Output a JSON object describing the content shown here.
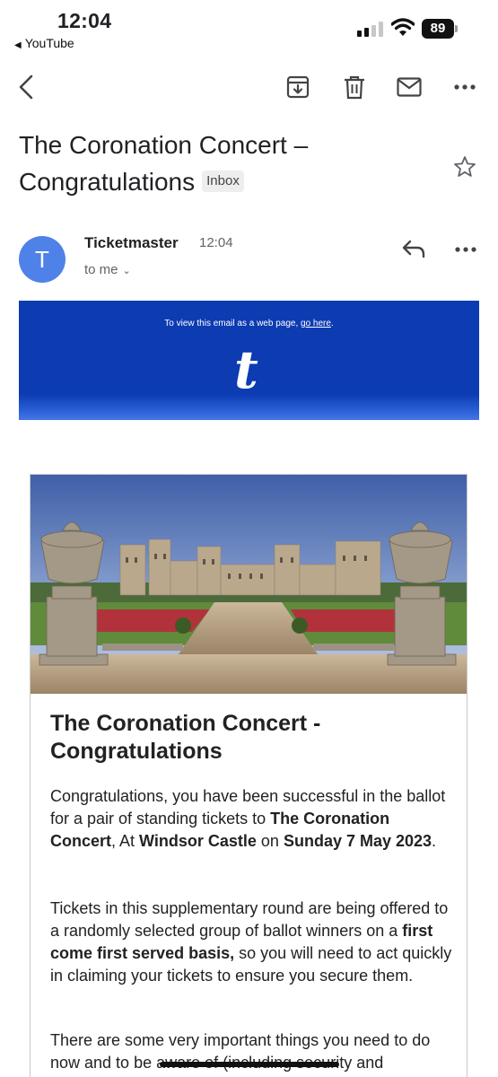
{
  "status_bar": {
    "time": "12:04",
    "back_app": "YouTube",
    "battery": "89"
  },
  "toolbar": {
    "back_icon": "chevron-left-icon",
    "archive_icon": "archive-icon",
    "delete_icon": "trash-icon",
    "mark_unread_icon": "mail-icon",
    "more_icon": "more-horizontal-icon"
  },
  "email": {
    "subject_line1": "The Coronation Concert –",
    "subject_line2": "Congratulations",
    "label": "Inbox",
    "star_icon": "star-outline-icon",
    "sender_initial": "T",
    "sender_name": "Ticketmaster",
    "time": "12:04",
    "recipient": "to me",
    "reply_icon": "reply-icon",
    "accent_color": "#4f82e8"
  },
  "banner": {
    "text_prefix": "To view this email as a web page, ",
    "link_text": "go here",
    "text_suffix": ".",
    "logo": "t",
    "color": "#0c3bb2"
  },
  "content": {
    "title_line1": "The Coronation Concert -",
    "title_line2": "Congratulations",
    "p1": {
      "a": "Congratulations, you have been successful in the ballot for a pair of standing tickets to ",
      "b": "The Coronation Concert",
      "c": ", At ",
      "d": "Windsor Castle",
      "e": " on ",
      "f": "Sunday 7 May 2023",
      "g": "."
    },
    "p2": {
      "a": "Tickets in this supplementary round are being offered to a randomly selected group of ballot winners on a ",
      "b": "first come first served basis,",
      "c": " so you will need to act quickly in claiming your tickets to ensure you secure them."
    },
    "p3": {
      "a": "There are some very important things you need to do now and to be aware of (including security and"
    }
  }
}
